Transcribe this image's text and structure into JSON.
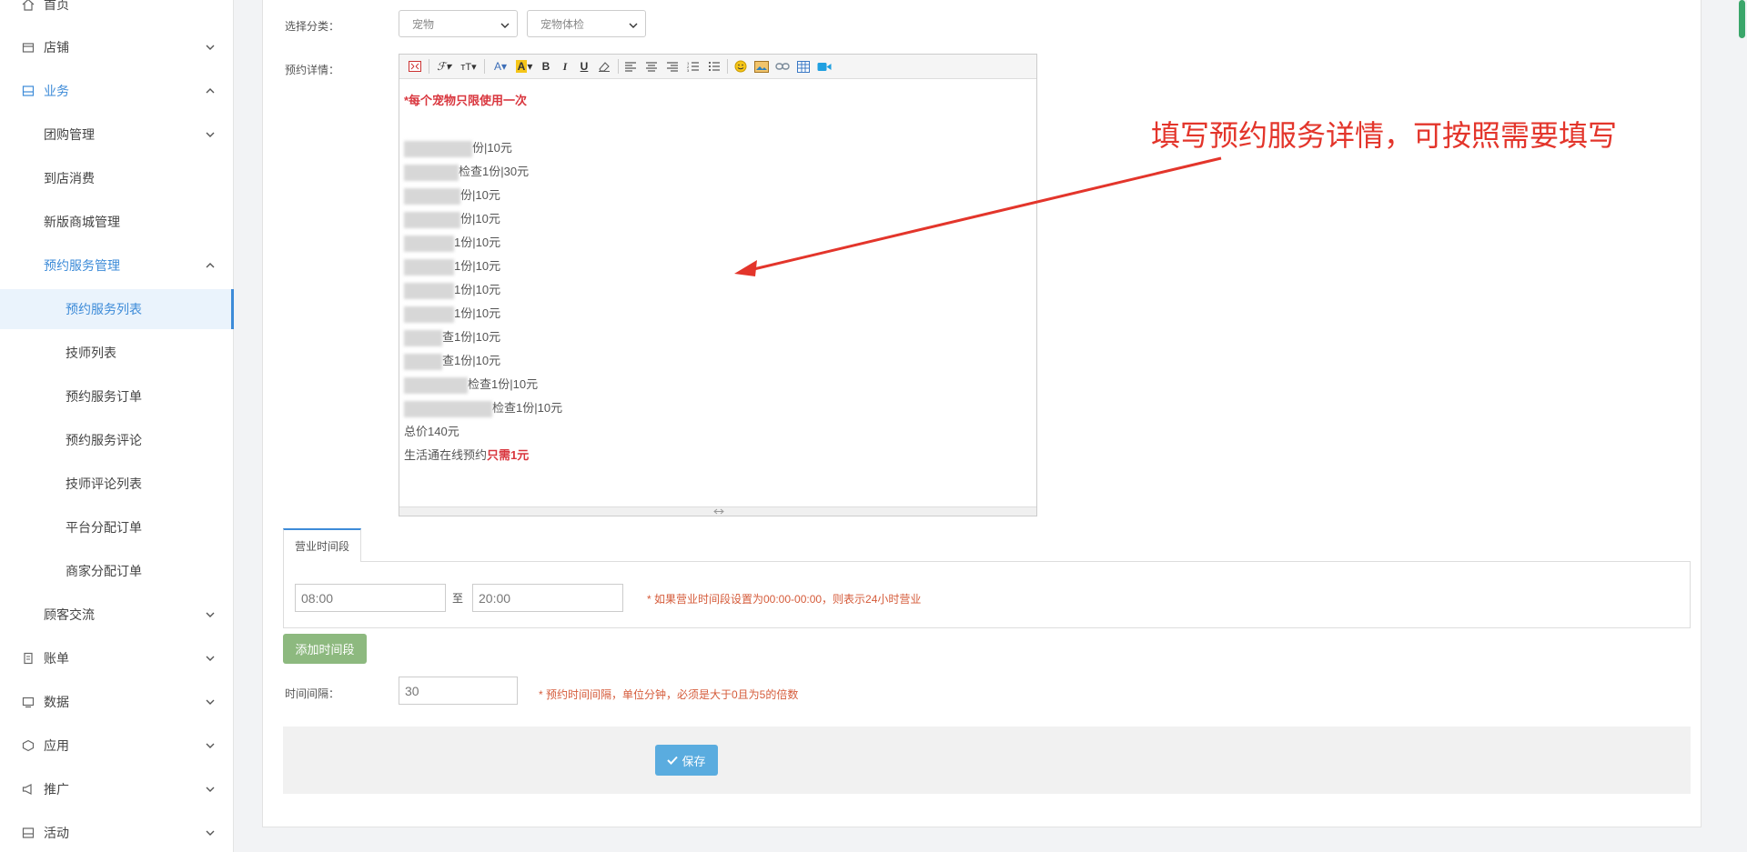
{
  "sidebar": {
    "items": [
      {
        "label": "首页",
        "icon": "home-icon"
      },
      {
        "label": "店铺",
        "icon": "store-icon"
      },
      {
        "label": "业务",
        "icon": "business-icon"
      },
      {
        "label": "团购管理"
      },
      {
        "label": "到店消费"
      },
      {
        "label": "新版商城管理"
      },
      {
        "label": "预约服务管理"
      },
      {
        "label": "预约服务列表"
      },
      {
        "label": "技师列表"
      },
      {
        "label": "预约服务订单"
      },
      {
        "label": "预约服务评论"
      },
      {
        "label": "技师评论列表"
      },
      {
        "label": "平台分配订单"
      },
      {
        "label": "商家分配订单"
      },
      {
        "label": "顾客交流"
      },
      {
        "label": "账单",
        "icon": "bill-icon"
      },
      {
        "label": "数据",
        "icon": "data-icon"
      },
      {
        "label": "应用",
        "icon": "app-icon"
      },
      {
        "label": "推广",
        "icon": "promote-icon"
      },
      {
        "label": "活动",
        "icon": "activity-icon"
      }
    ]
  },
  "form": {
    "category_label": "选择分类：",
    "category_select_1": "宠物",
    "category_select_2": "宠物体检",
    "detail_label": "预约详情：",
    "interval_label": "时间间隔：",
    "interval_value": "30",
    "interval_hint": "* 预约时间间隔，单位分钟，必须是大于0且为5的倍数"
  },
  "editor": {
    "lines": [
      "*每个宠物只限使用一次",
      "份|10元",
      "检查1份|30元",
      "份|10元",
      "份|10元",
      "1份|10元",
      "1份|10元",
      "1份|10元",
      "1份|10元",
      "查1份|10元",
      "查1份|10元",
      "检查1份|10元",
      "检查1份|10元",
      "总价140元",
      "生活通在线预约",
      "只需1元"
    ]
  },
  "annotation": {
    "text": "填写预约服务详情，可按照需要填写",
    "color": "#e3352b"
  },
  "hours": {
    "tab_label": "营业时间段",
    "start_value": "08:00",
    "to_label": "至",
    "end_value": "20:00",
    "hint": "* 如果营业时间段设置为00:00-00:00，则表示24小时营业",
    "add_button": "添加时间段"
  },
  "actions": {
    "save_button": "保存"
  },
  "colors": {
    "accent": "#3d8bd8",
    "green_button": "#8db97f",
    "save_button": "#5aacdf",
    "hint": "#d55b3a"
  }
}
